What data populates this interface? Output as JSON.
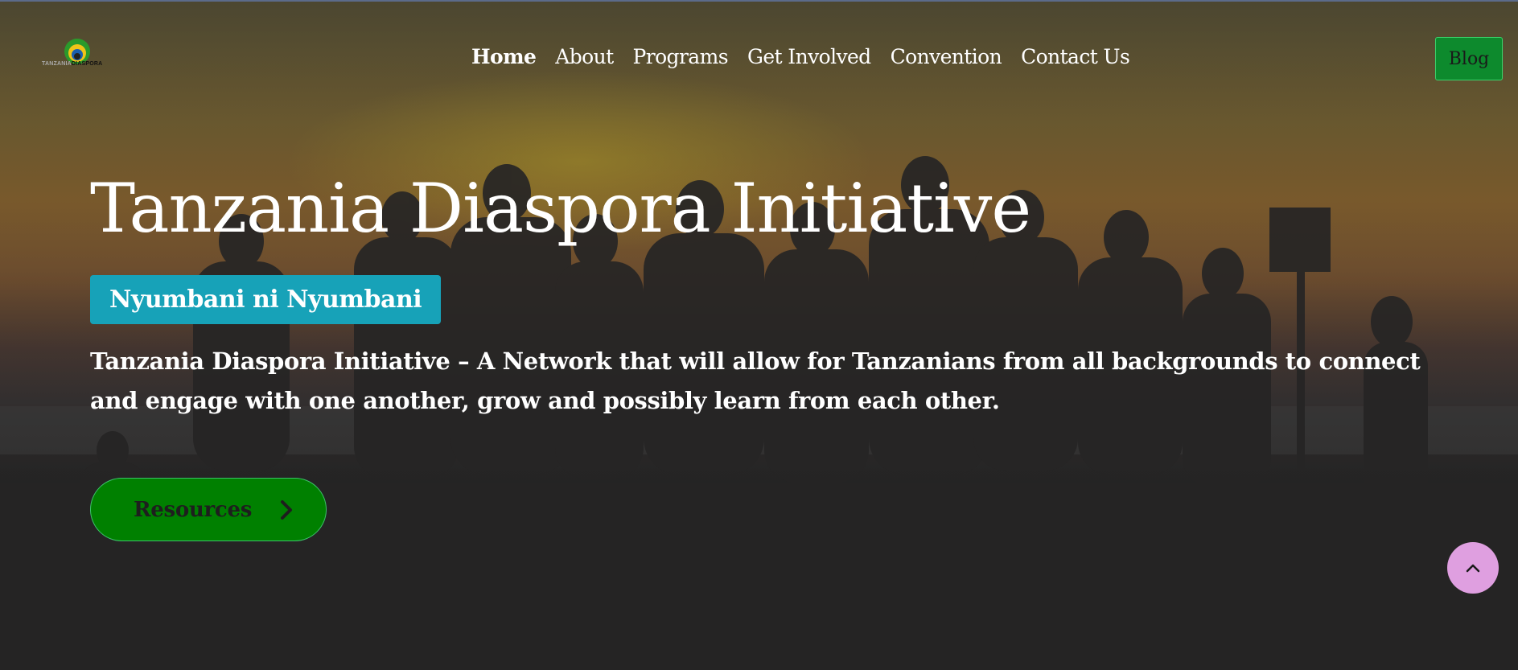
{
  "logo": {
    "text_part1": "TANZANIA",
    "text_part2": "DIASPORA",
    "icon": "tanzania-diaspora-logo-icon"
  },
  "nav": {
    "items": [
      {
        "label": "Home",
        "active": true
      },
      {
        "label": "About"
      },
      {
        "label": "Programs"
      },
      {
        "label": "Get Involved"
      },
      {
        "label": "Convention"
      },
      {
        "label": "Contact Us"
      }
    ],
    "blog_label": "Blog"
  },
  "hero": {
    "title": "Tanzania Diaspora Initiative",
    "tagline": "Nyumbani ni Nyumbani",
    "description": "Tanzania Diaspora Initiative – A Network that will allow for Tanzanians from all backgrounds to connect and engage with one another, grow and possibly learn from each other.",
    "cta_label": "Resources",
    "cta_icon": "chevron-right-icon"
  },
  "scroll_top": {
    "icon": "chevron-up-icon"
  },
  "colors": {
    "tagline_bg": "#17a2b8",
    "green_button": "#008000",
    "blog_button": "#0d8a2d",
    "scroll_top_bg": "#df9fe0"
  }
}
